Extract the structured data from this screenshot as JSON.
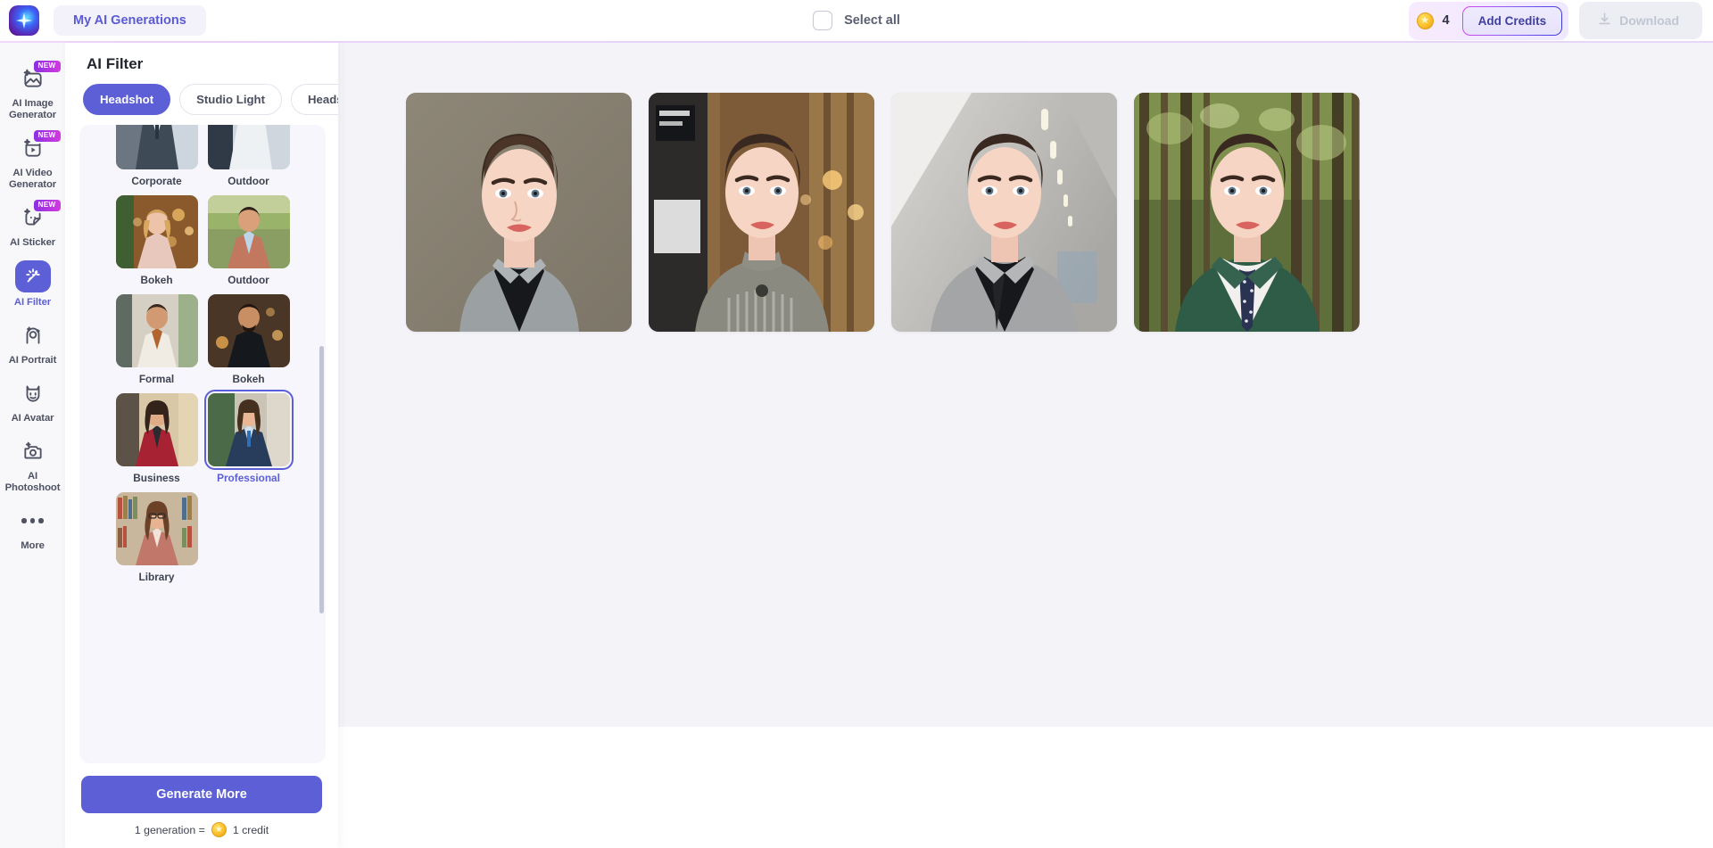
{
  "app": {
    "logo_icon": "sparkle-star-logo",
    "my_generations_label": "My AI Generations"
  },
  "topbar": {
    "select_all_label": "Select all",
    "select_all_checked": false,
    "credit_count": "4",
    "coin_icon": "coin-icon",
    "add_credits_label": "Add Credits",
    "download_label": "Download",
    "download_icon": "download-icon",
    "download_disabled": true
  },
  "sidebar": {
    "items": [
      {
        "label": "AI Image Generator",
        "icon": "image-generator-icon",
        "badge": "NEW",
        "active": false
      },
      {
        "label": "AI Video Generator",
        "icon": "video-generator-icon",
        "badge": "NEW",
        "active": false
      },
      {
        "label": "AI Sticker",
        "icon": "sticker-icon",
        "badge": "NEW",
        "active": false
      },
      {
        "label": "AI Filter",
        "icon": "filter-sparkle-icon",
        "badge": "",
        "active": true
      },
      {
        "label": "AI Portrait",
        "icon": "portrait-icon",
        "badge": "",
        "active": false
      },
      {
        "label": "AI Avatar",
        "icon": "avatar-icon",
        "badge": "",
        "active": false
      },
      {
        "label": "AI Photoshoot",
        "icon": "camera-icon",
        "badge": "",
        "active": false
      },
      {
        "label": "More",
        "icon": "ellipsis-icon",
        "badge": "",
        "active": false
      }
    ]
  },
  "panel": {
    "title": "AI Filter",
    "tabs": [
      {
        "label": "Headshot",
        "active": true
      },
      {
        "label": "Studio Light",
        "active": false
      },
      {
        "label": "Headsh",
        "active": false
      }
    ],
    "filters": [
      {
        "label": "Corporate",
        "selected": false,
        "style": "corporate"
      },
      {
        "label": "Outdoor",
        "selected": false,
        "style": "outdoor-office"
      },
      {
        "label": "Bokeh",
        "selected": false,
        "style": "bokeh-warm"
      },
      {
        "label": "Outdoor",
        "selected": false,
        "style": "outdoor-green"
      },
      {
        "label": "Formal",
        "selected": false,
        "style": "formal"
      },
      {
        "label": "Bokeh",
        "selected": false,
        "style": "bokeh-dark"
      },
      {
        "label": "Business",
        "selected": false,
        "style": "business-red"
      },
      {
        "label": "Professional",
        "selected": true,
        "style": "professional-navy"
      },
      {
        "label": "Library",
        "selected": false,
        "style": "library"
      }
    ],
    "generate_label": "Generate More",
    "credit_note_prefix": "1 generation =",
    "credit_note_suffix": "1 credit",
    "coin_icon": "coin-icon"
  },
  "results": [
    {
      "name": "result-1",
      "background": "studio-grey",
      "outfit": "grey-shirt-black-tie"
    },
    {
      "name": "result-2",
      "background": "cafe-warm-bokeh",
      "outfit": "grey-mandarin-collar"
    },
    {
      "name": "result-3",
      "background": "office-corridor",
      "outfit": "grey-suit-black-tie"
    },
    {
      "name": "result-4",
      "background": "forest-trees",
      "outfit": "green-blazer-white-shirt"
    }
  ],
  "colors": {
    "accent": "#5d5fd6",
    "panel_bg": "#f6f6fc",
    "canvas_bg": "#f4f4f8",
    "badge_gradient_start": "#8b2fe0",
    "badge_gradient_end": "#d33ae0"
  }
}
